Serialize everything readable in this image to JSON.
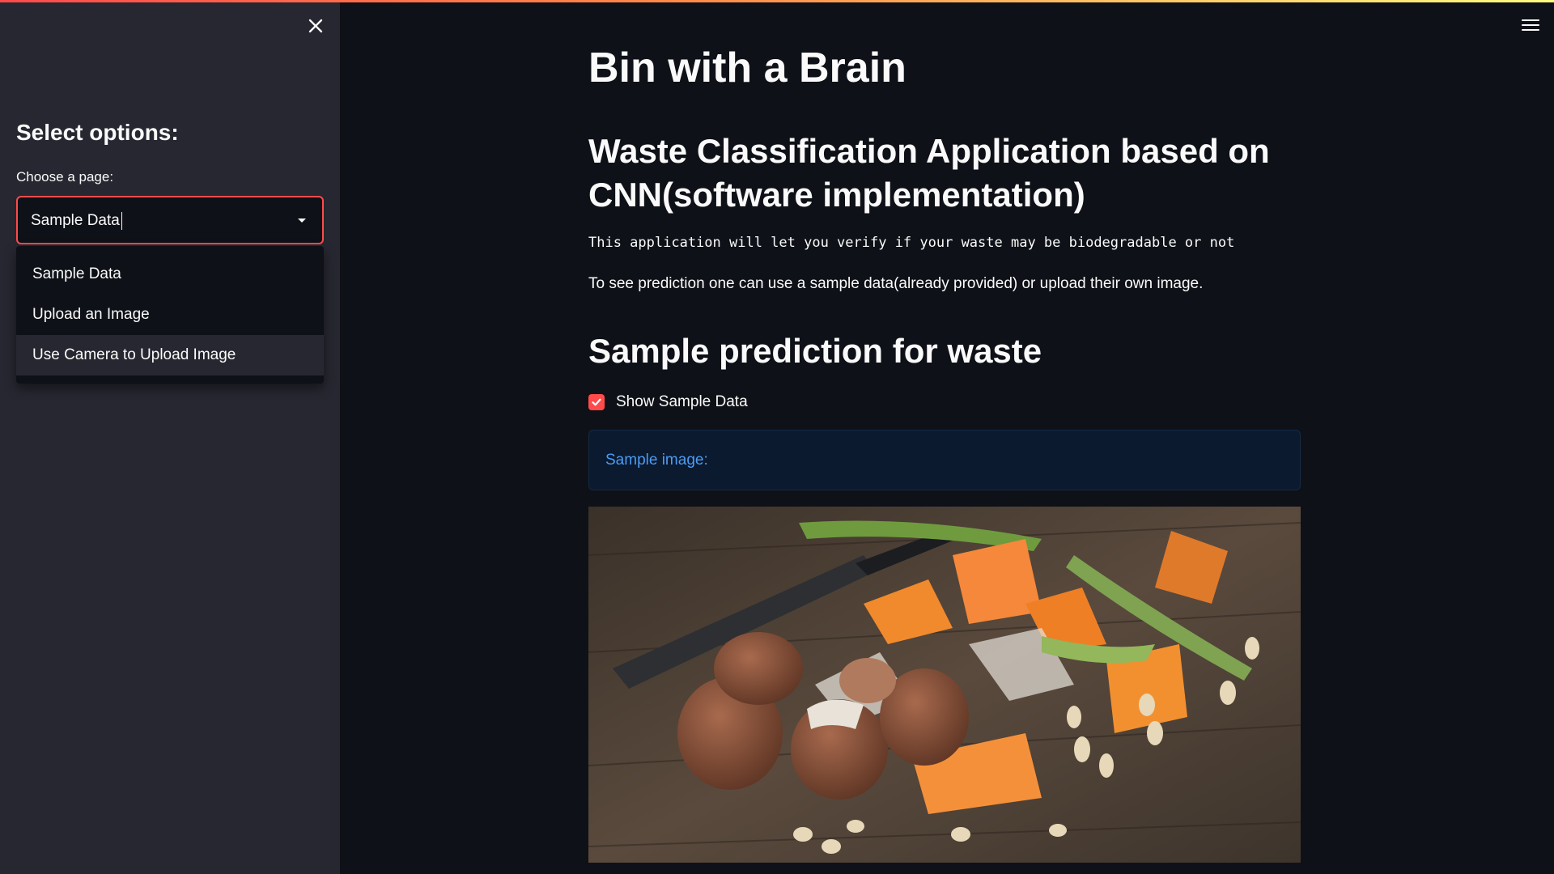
{
  "sidebar": {
    "title": "Select options:",
    "select_label": "Choose a page:",
    "selected_value": "Sample Data",
    "options": [
      "Sample Data",
      "Upload an Image",
      "Use Camera to Upload Image"
    ]
  },
  "main": {
    "title": "Bin with a Brain",
    "subtitle": "Waste Classification Application based on CNN(software implementation)",
    "description": "This application will let you verify if your waste may be biodegradable or not",
    "paragraph": "To see prediction one can use a sample data(already provided) or upload their own image.",
    "section_title": "Sample prediction for waste",
    "checkbox_label": "Show Sample Data",
    "checkbox_checked": true,
    "info_text": "Sample image:"
  },
  "colors": {
    "accent": "#ff4b4b",
    "background": "#0e1117",
    "sidebar": "#262730",
    "info_text": "#4c9cf5"
  },
  "icons": [
    "close-icon",
    "hamburger-menu-icon",
    "checkmark-icon",
    "chevron-down-icon"
  ]
}
